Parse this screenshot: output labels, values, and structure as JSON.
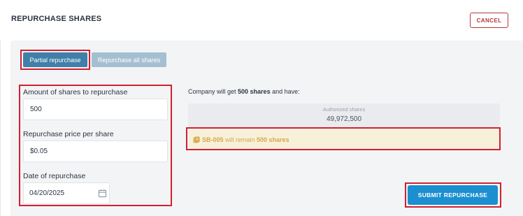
{
  "header": {
    "title": "REPURCHASE SHARES",
    "cancel_label": "CANCEL"
  },
  "mode_toggle": {
    "partial_label": "Partial repurchase",
    "all_label": "Repurchase all shares",
    "selected": "Partial repurchase"
  },
  "form": {
    "amount_label": "Amount of shares to repurchase",
    "amount_value": "500",
    "price_label": "Repurchase price per share",
    "price_value": "$0.05",
    "date_label": "Date of repurchase",
    "date_value": "04/20/2025"
  },
  "summary": {
    "company_prefix": "Company will get ",
    "company_shares": "500 shares",
    "company_suffix": " and have:",
    "authorized_label": "Authorized shares",
    "authorized_value": "49,972,500",
    "remain_id": "SB-005",
    "remain_text": " will remain ",
    "remain_shares": "500 shares"
  },
  "actions": {
    "submit_label": "SUBMIT REPURCHASE"
  },
  "icons": {
    "date": "calendar-icon",
    "certificate": "certificate-icon"
  },
  "colors": {
    "accent": "#1c8fd0",
    "toggle_active": "#3f7fa8",
    "toggle_inactive": "#a5bfd2",
    "danger": "#b43a3a",
    "highlight": "#d1202f",
    "warning_bg": "#f7f1d9",
    "warning_text": "#d7a64a"
  }
}
